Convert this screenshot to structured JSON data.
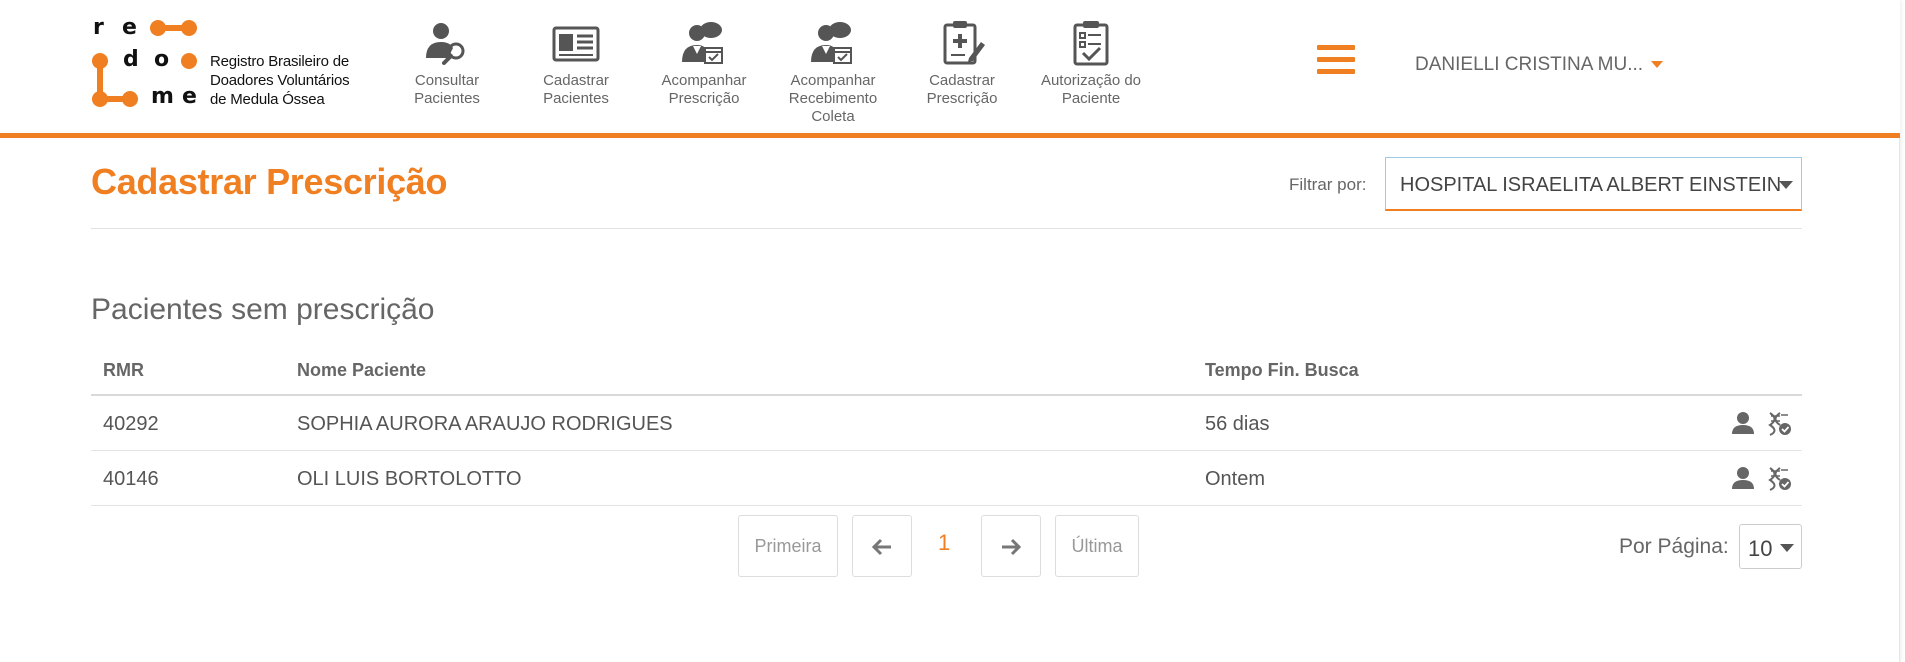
{
  "app": {
    "logo": {
      "letters": [
        "r",
        "e",
        "d",
        "o",
        "m",
        "e"
      ],
      "lines": [
        "Registro Brasileiro de",
        "Doadores Voluntários",
        "de Medula Óssea"
      ]
    },
    "accent_color": "#f07f22"
  },
  "nav": {
    "items": [
      {
        "label": "Consultar\nPacientes",
        "icon": "user-search-icon"
      },
      {
        "label": "Cadastrar\nPacientes",
        "icon": "id-card-icon"
      },
      {
        "label": "Acompanhar\nPrescrição",
        "icon": "doctor-calendar-icon"
      },
      {
        "label": "Acompanhar\nRecebimento\nColeta",
        "icon": "doctor-calendar-icon"
      },
      {
        "label": "Cadastrar\nPrescrição",
        "icon": "clipboard-edit-icon"
      },
      {
        "label": "Autorização do\nPaciente",
        "icon": "clipboard-check-icon"
      }
    ]
  },
  "user": {
    "name": "DANIELLI CRISTINA MU..."
  },
  "page": {
    "title": "Cadastrar Prescrição",
    "filter_label": "Filtrar por:",
    "filter_value": "HOSPITAL ISRAELITA ALBERT EINSTEIN"
  },
  "section": {
    "title": "Pacientes sem prescrição"
  },
  "table": {
    "columns": [
      "RMR",
      "Nome Paciente",
      "Tempo Fin. Busca"
    ],
    "rows": [
      {
        "rmr": "40292",
        "name": "SOPHIA AURORA ARAUJO RODRIGUES",
        "time": "56 dias"
      },
      {
        "rmr": "40146",
        "name": "OLI LUIS BORTOLOTTO",
        "time": "Ontem"
      }
    ]
  },
  "pagination": {
    "first": "Primeira",
    "last": "Última",
    "current": "1",
    "per_page_label": "Por Página:",
    "per_page_value": "10"
  }
}
